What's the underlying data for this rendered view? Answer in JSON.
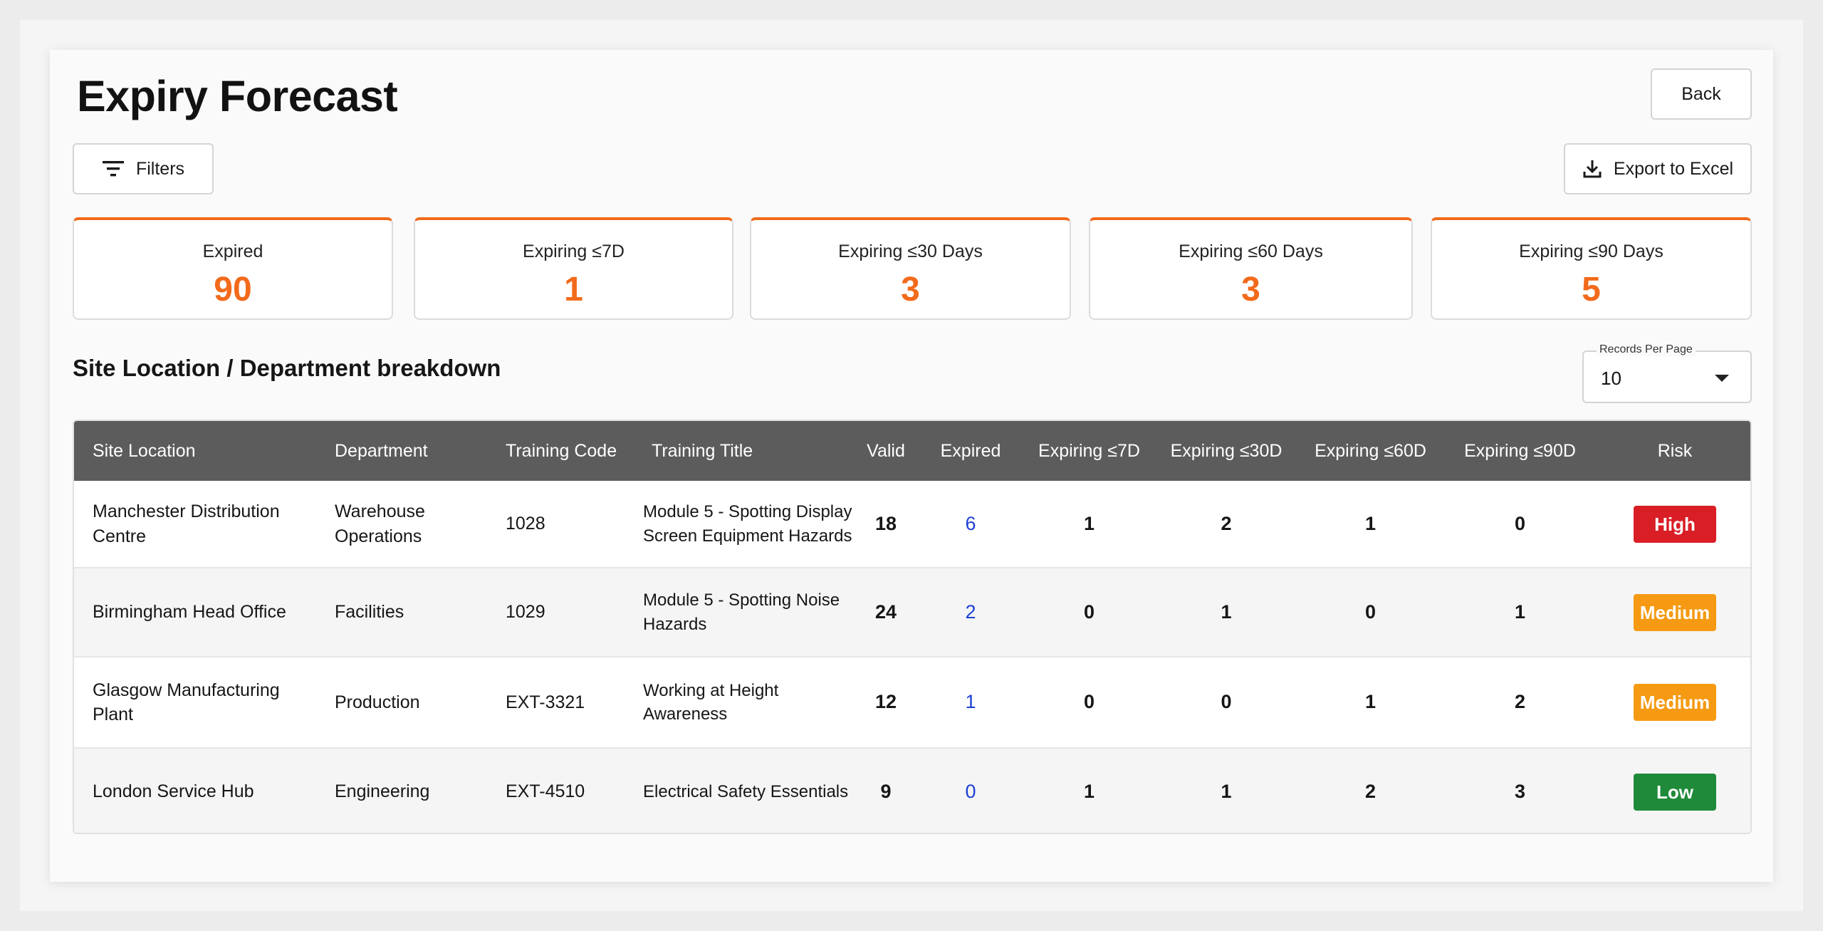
{
  "page": {
    "title": "Expiry Forecast"
  },
  "toolbar": {
    "back_label": "Back",
    "filters_label": "Filters",
    "export_label": "Export to Excel"
  },
  "stats": [
    {
      "label": "Expired",
      "value": "90"
    },
    {
      "label": "Expiring ≤7D",
      "value": "1"
    },
    {
      "label": "Expiring ≤30 Days",
      "value": "3"
    },
    {
      "label": "Expiring ≤60 Days",
      "value": "3"
    },
    {
      "label": "Expiring ≤90 Days",
      "value": "5"
    }
  ],
  "breakdown": {
    "title": "Site Location / Department breakdown",
    "records_per_page_label": "Records Per Page",
    "records_per_page_value": "10"
  },
  "table": {
    "headers": [
      "Site Location",
      "Department",
      "Training Code",
      "Training Title",
      "Valid",
      "Expired",
      "Expiring ≤7D",
      "Expiring ≤30D",
      "Expiring ≤60D",
      "Expiring ≤90D",
      "Risk"
    ],
    "rows": [
      {
        "site": "Manchester Distribution Centre",
        "department": "Warehouse Operations",
        "code": "1028",
        "title": "Module 5 - Spotting Display Screen Equipment Hazards",
        "valid": "18",
        "expired": "6",
        "exp7": "1",
        "exp30": "2",
        "exp60": "1",
        "exp90": "0",
        "risk": "High"
      },
      {
        "site": "Birmingham Head Office",
        "department": "Facilities",
        "code": "1029",
        "title": "Module 5 - Spotting Noise Hazards",
        "valid": "24",
        "expired": "2",
        "exp7": "0",
        "exp30": "1",
        "exp60": "0",
        "exp90": "1",
        "risk": "Medium"
      },
      {
        "site": "Glasgow Manufacturing Plant",
        "department": "Production",
        "code": "EXT-3321",
        "title": "Working at Height Awareness",
        "valid": "12",
        "expired": "1",
        "exp7": "0",
        "exp30": "0",
        "exp60": "1",
        "exp90": "2",
        "risk": "Medium"
      },
      {
        "site": "London Service Hub",
        "department": "Engineering",
        "code": "EXT-4510",
        "title": "Electrical Safety Essentials",
        "valid": "9",
        "expired": "0",
        "exp7": "1",
        "exp30": "1",
        "exp60": "2",
        "exp90": "3",
        "risk": "Low"
      }
    ]
  },
  "colors": {
    "accent": "#f26a1b",
    "header_bg": "#5c5c5c",
    "link": "#1c3fd4",
    "risk_high": "#d91e26",
    "risk_medium": "#f59a12",
    "risk_low": "#1f8a3a"
  },
  "icons": {
    "filters": "filter-lines-icon",
    "export": "download-icon",
    "dropdown": "caret-down-icon"
  }
}
